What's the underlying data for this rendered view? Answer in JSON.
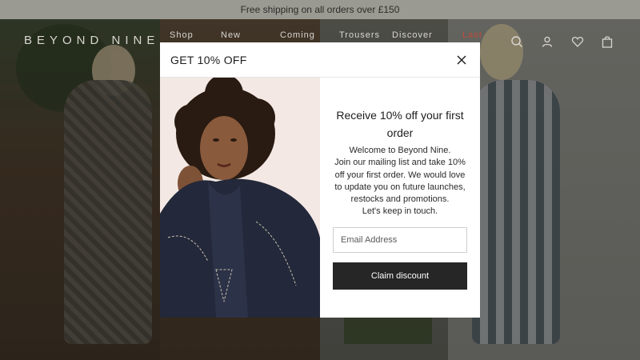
{
  "announcement": {
    "text": "Free shipping on all orders over £150"
  },
  "header": {
    "logo": "BEYOND NINE",
    "nav": [
      {
        "label": "Shop"
      },
      {
        "label": "New"
      },
      {
        "label": "Coming"
      },
      {
        "label": "Trousers"
      },
      {
        "label": "Discover"
      },
      {
        "label": "Last"
      }
    ],
    "icons": [
      "search-icon",
      "account-icon",
      "wishlist-icon",
      "bag-icon"
    ]
  },
  "modal": {
    "title": "GET 10% OFF",
    "headline": "Receive 10% off your first order",
    "copy_lines": [
      "Welcome to Beyond Nine.",
      "Join our mailing list and take 10%",
      "off your first order. We would love",
      "to update you on future launches,",
      "restocks and promotions.",
      "Let's keep in touch."
    ],
    "email_placeholder": "Email Address",
    "button_label": "Claim discount"
  },
  "colors": {
    "sale": "#c14a3a",
    "button": "#262626",
    "announce_bg": "#9a9a92"
  }
}
